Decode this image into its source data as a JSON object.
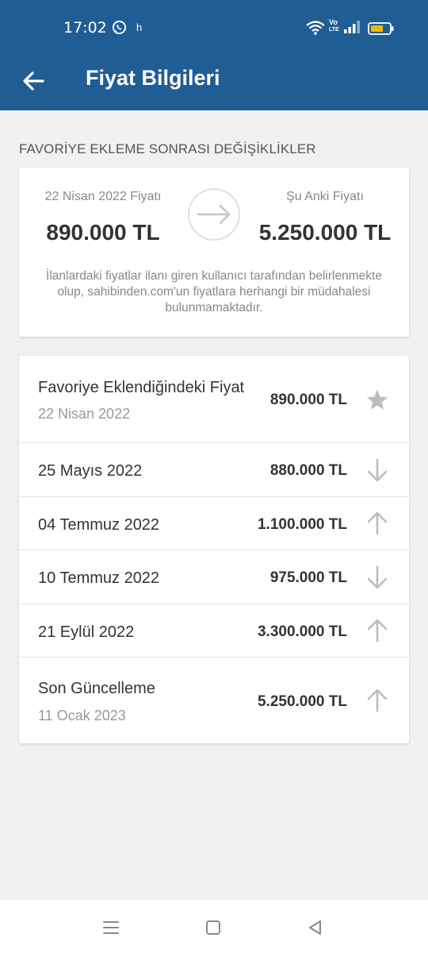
{
  "status": {
    "time": "17:02",
    "extra": "h",
    "volte_top": "Vo",
    "volte_bottom": "LTE"
  },
  "header": {
    "title": "Fiyat Bilgileri"
  },
  "section": {
    "title": "FAVORİYE EKLEME SONRASI DEĞİŞİKLİKLER"
  },
  "summary": {
    "left_label": "22 Nisan 2022 Fiyatı",
    "left_value": "890.000 TL",
    "right_label": "Şu Anki Fiyatı",
    "right_value": "5.250.000 TL",
    "disclaimer": "İlanlardaki fiyatlar ilanı giren kullanıcı tarafından belirlenmekte olup, sahibinden.com'un fiyatlara herhangi bir müdahalesi bulunmamaktadır."
  },
  "history": [
    {
      "title": "Favoriye Eklendiğindeki Fiyat",
      "subtitle": "22 Nisan 2022",
      "price": "890.000 TL",
      "icon": "star-icon"
    },
    {
      "title": "25 Mayıs 2022",
      "subtitle": "",
      "price": "880.000 TL",
      "icon": "arrow-down-icon"
    },
    {
      "title": "04 Temmuz 2022",
      "subtitle": "",
      "price": "1.100.000 TL",
      "icon": "arrow-up-icon"
    },
    {
      "title": "10 Temmuz 2022",
      "subtitle": "",
      "price": "975.000 TL",
      "icon": "arrow-down-icon"
    },
    {
      "title": "21 Eylül 2022",
      "subtitle": "",
      "price": "3.300.000 TL",
      "icon": "arrow-up-icon"
    },
    {
      "title": "Son Güncelleme",
      "subtitle": "11 Ocak 2023",
      "price": "5.250.000 TL",
      "icon": "arrow-up-icon"
    }
  ],
  "colors": {
    "header_bg": "#215d95",
    "icon_gray": "#bdbdbd",
    "battery": "#f2b705"
  }
}
